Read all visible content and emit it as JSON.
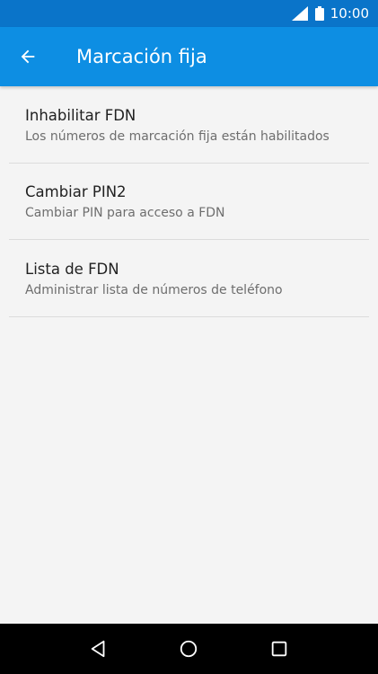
{
  "status_bar": {
    "time": "10:00",
    "icons": [
      "signal-icon",
      "battery-icon"
    ]
  },
  "app_bar": {
    "title": "Marcación fija",
    "back_icon": "arrow-left-icon",
    "color": "#0d8ee3",
    "status_color": "#0a74c9"
  },
  "settings": {
    "items": [
      {
        "title": "Inhabilitar FDN",
        "summary": "Los números de marcación fija están habilitados"
      },
      {
        "title": "Cambiar PIN2",
        "summary": "Cambiar PIN para acceso a FDN"
      },
      {
        "title": "Lista de FDN",
        "summary": "Administrar lista de números de teléfono"
      }
    ]
  },
  "nav_bar": {
    "buttons": [
      "back-triangle-icon",
      "home-circle-icon",
      "recents-square-icon"
    ]
  }
}
